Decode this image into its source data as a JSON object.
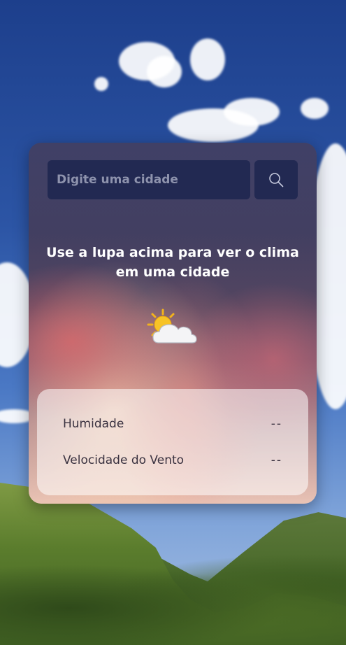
{
  "search": {
    "placeholder": "Digite uma cidade",
    "value": ""
  },
  "icons": {
    "search_button": "search-icon",
    "weather": "sun-behind-cloud-icon"
  },
  "main": {
    "message": "Use a lupa acima para ver o clima em uma cidade"
  },
  "details": {
    "humidity_label": "Humidade",
    "humidity_value": "--",
    "wind_label": "Velocidade do Vento",
    "wind_value": "--"
  },
  "colors": {
    "input_background": "#1c244e",
    "text_light": "#ffffff",
    "panel_text": "#3a3240"
  }
}
